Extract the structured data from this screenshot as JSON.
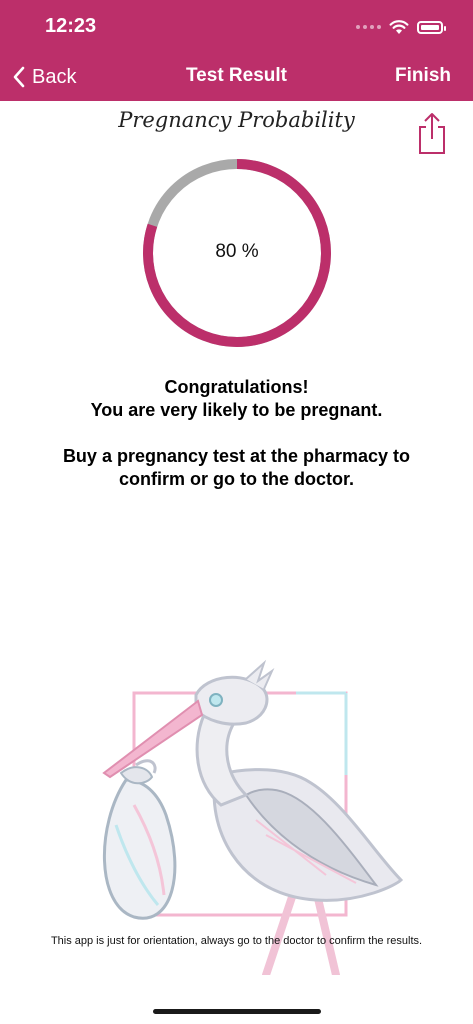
{
  "status_bar": {
    "time": "12:23"
  },
  "nav": {
    "back_label": "Back",
    "title": "Test Result",
    "finish_label": "Finish"
  },
  "result": {
    "heading": "Pregnancy Probability",
    "probability_text": "80 %",
    "probability": 0.8,
    "message_line1": "Congratulations!",
    "message_line2": "You are very likely to be pregnant.",
    "advice_line1": "Buy a pregnancy test at the pharmacy to",
    "advice_line2": "confirm or go to the doctor."
  },
  "disclaimer": "This app is just for orientation, always go to the doctor to confirm the results.",
  "colors": {
    "accent": "#bc2f6a",
    "track": "#a9a9a9"
  },
  "icons": {
    "back": "chevron-left-icon",
    "share": "share-icon",
    "wifi": "wifi-icon",
    "battery": "battery-icon",
    "illustration": "stork-with-bundle"
  }
}
